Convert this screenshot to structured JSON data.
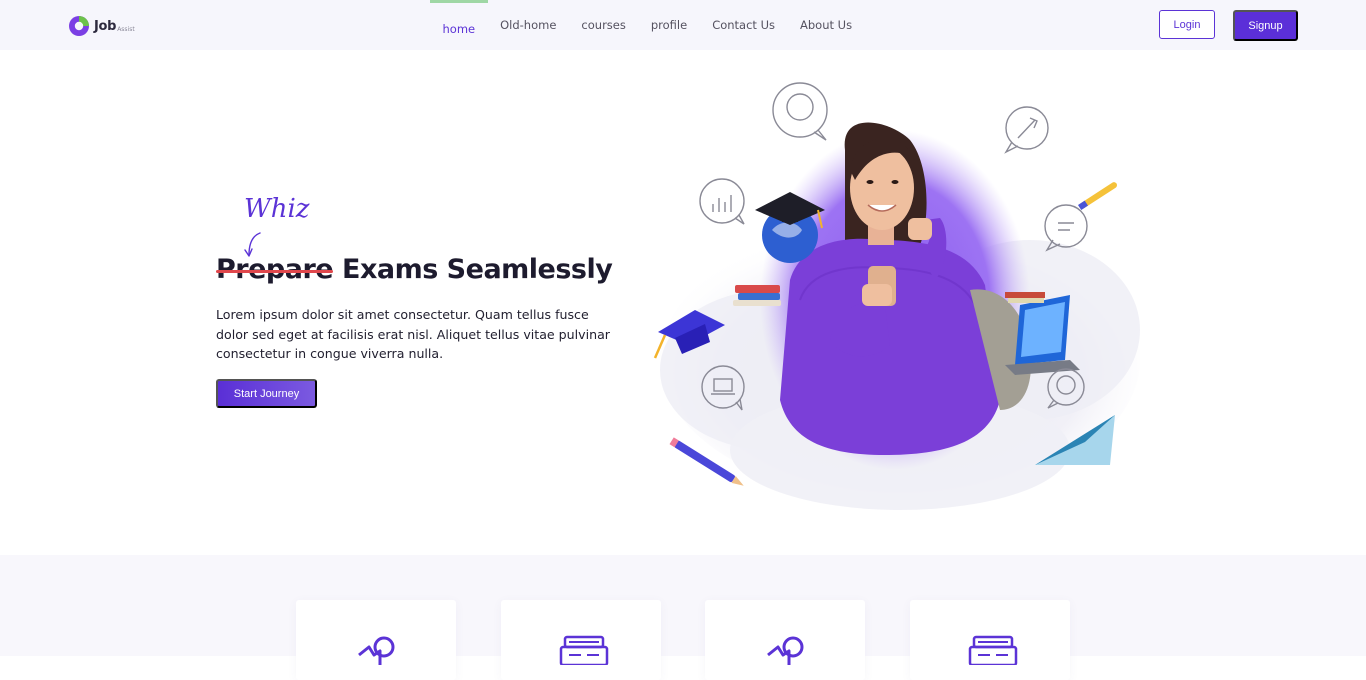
{
  "brand": {
    "name": "Job",
    "tagline": "Assist"
  },
  "nav": {
    "items": [
      {
        "label": "home",
        "active": true
      },
      {
        "label": "Old-home",
        "active": false
      },
      {
        "label": "courses",
        "active": false
      },
      {
        "label": "profile",
        "active": false
      },
      {
        "label": "Contact Us",
        "active": false
      },
      {
        "label": "About Us",
        "active": false
      }
    ]
  },
  "auth": {
    "login_label": "Login",
    "signup_label": "Signup"
  },
  "hero": {
    "annotation": "Whiz",
    "headline_struck": "Prepare",
    "headline_rest": "Exams Seamlessly",
    "body": "Lorem ipsum dolor sit amet consectetur. Quam tellus fusce dolor sed eget at facilisis erat nisl. Aliquet tellus vitae pulvinar consectetur in congue viverra nulla.",
    "cta_label": "Start Journey"
  },
  "features": {
    "cards": [
      {
        "icon": "medal-icon"
      },
      {
        "icon": "books-icon"
      },
      {
        "icon": "medal-icon"
      },
      {
        "icon": "books-icon"
      }
    ]
  },
  "colors": {
    "accent": "#5b33d6",
    "strike": "#e0474c",
    "active_indicator": "#9fd7a5",
    "nav_background": "#f6f6fc"
  }
}
